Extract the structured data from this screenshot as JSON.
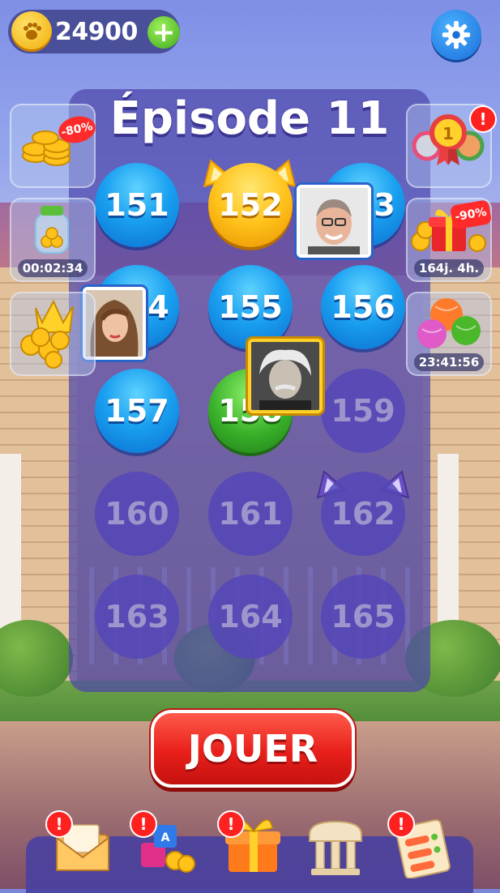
{
  "currency": {
    "coins": "24900",
    "add_label": "+"
  },
  "episode": {
    "title": "Épisode 11"
  },
  "levels": [
    {
      "number": "151",
      "state": "done"
    },
    {
      "number": "152",
      "state": "current"
    },
    {
      "number": "153",
      "state": "done"
    },
    {
      "number": "154",
      "state": "done"
    },
    {
      "number": "155",
      "state": "done"
    },
    {
      "number": "156",
      "state": "done"
    },
    {
      "number": "157",
      "state": "done"
    },
    {
      "number": "158",
      "state": "active"
    },
    {
      "number": "159",
      "state": "locked"
    },
    {
      "number": "160",
      "state": "locked"
    },
    {
      "number": "161",
      "state": "locked"
    },
    {
      "number": "162",
      "state": "locked"
    },
    {
      "number": "163",
      "state": "locked"
    },
    {
      "number": "164",
      "state": "locked"
    },
    {
      "number": "165",
      "state": "locked"
    }
  ],
  "side_left": {
    "coin_offer": {
      "discount": "-80%"
    },
    "piggy_bank": {
      "timer": "00:02:34"
    },
    "crown_offer": {}
  },
  "side_right": {
    "rewards": {
      "alert": "!"
    },
    "gift_offer": {
      "discount": "-90%",
      "timer": "164j. 4h."
    },
    "yarn_offer": {
      "timer": "23:41:56"
    }
  },
  "play_button": {
    "label": "JOUER"
  },
  "dock": {
    "mail": {
      "alert": "!"
    },
    "toys": {
      "alert": "!"
    },
    "gift": {
      "alert": "!"
    },
    "temple": {},
    "tasks": {
      "alert": "!"
    }
  },
  "colors": {
    "level_done": "#1aa0f0",
    "level_current": "#ffc21a",
    "level_active": "#39b12a",
    "play": "#e81f1a"
  }
}
